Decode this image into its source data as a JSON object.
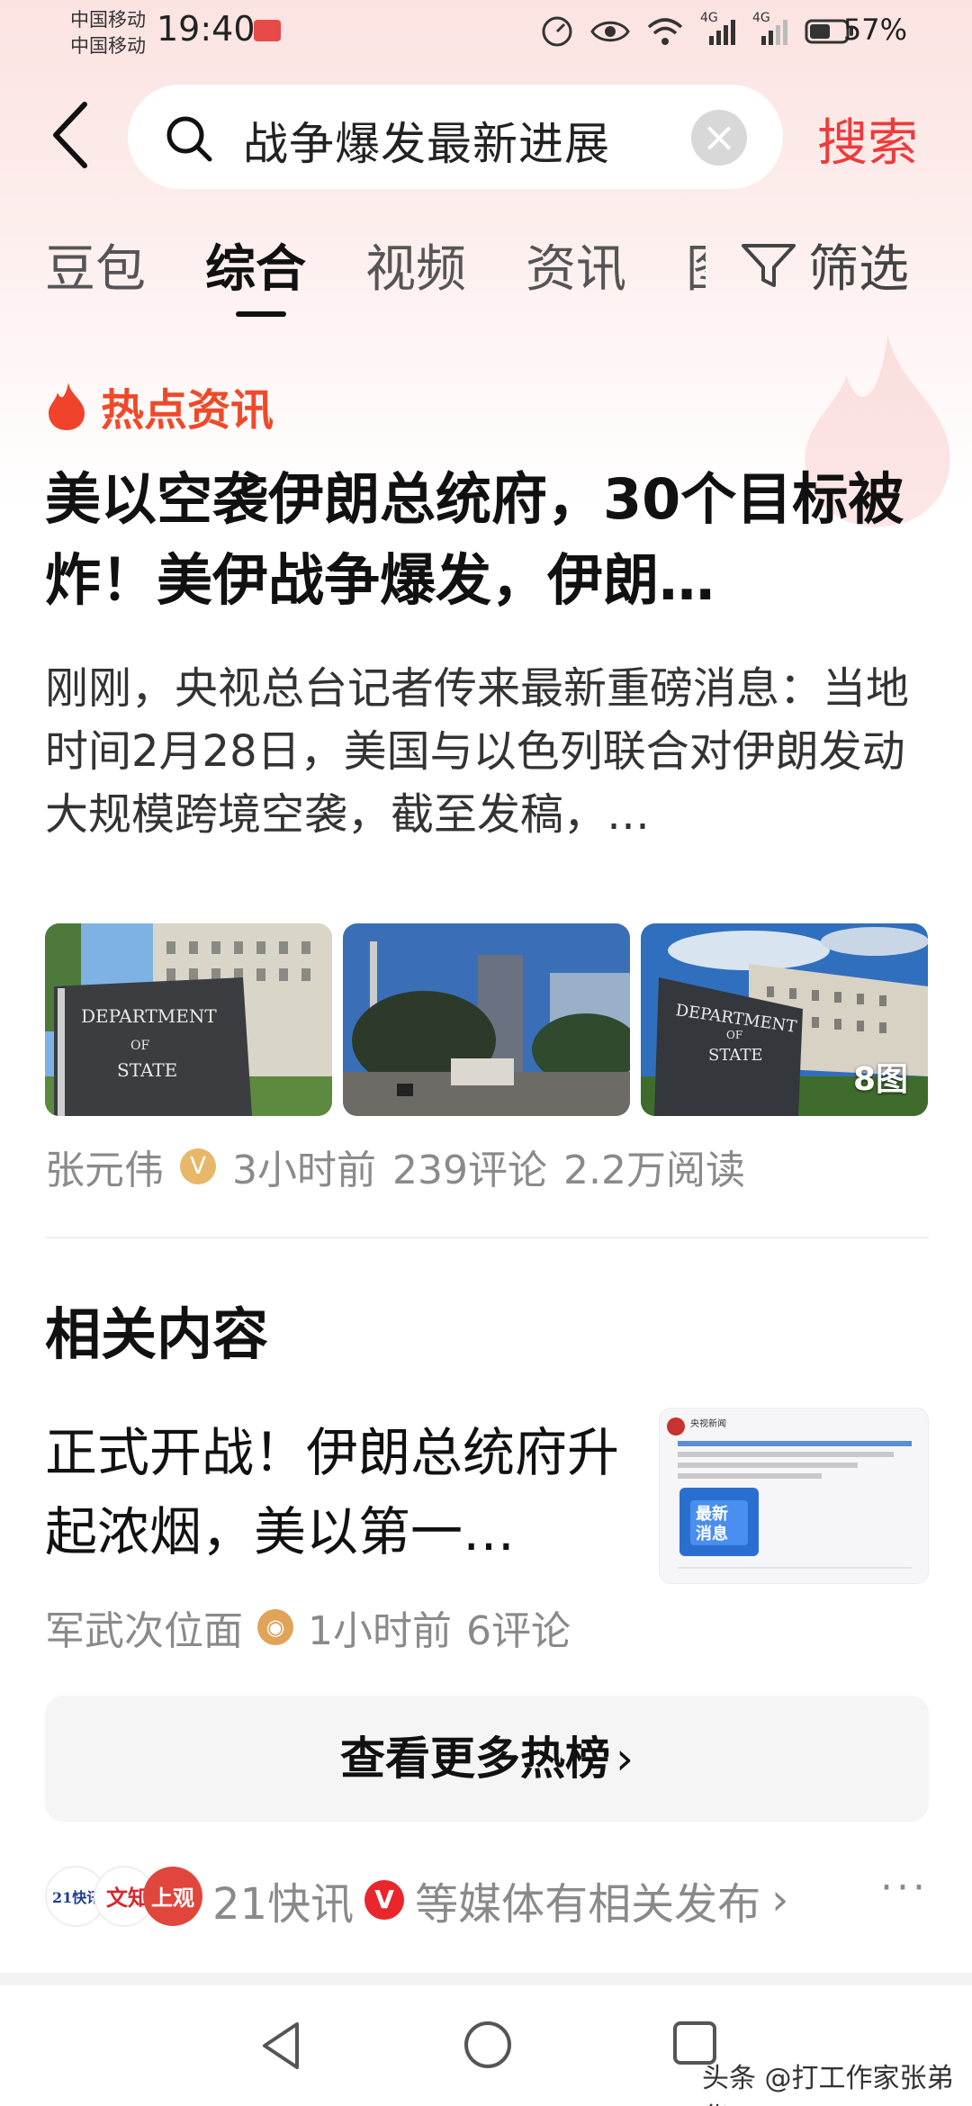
{
  "status_bar": {
    "carrier_1": "中国移动",
    "carrier_2": "中国移动",
    "time": "19:40",
    "battery": "57%",
    "signal_1": "4G",
    "signal_2": "4G"
  },
  "search": {
    "query": "战争爆发最新进展",
    "submit_label": "搜索"
  },
  "tabs": [
    {
      "label": "豆包"
    },
    {
      "label": "综合",
      "active": true
    },
    {
      "label": "视频"
    },
    {
      "label": "资讯"
    },
    {
      "label": "图"
    }
  ],
  "filter_label": "筛选",
  "hot_section": {
    "title": "热点资讯",
    "headline": "美以空袭伊朗总统府，30个目标被炸！美伊战争爆发，伊朗…",
    "summary": "刚刚，央视总台记者传来最新重磅消息：当地时间2月28日，美国与以色列联合对伊朗发动大规模跨境空袭，截至发稿，…",
    "photo_count": "8图",
    "author": "张元伟",
    "time_ago": "3小时前",
    "comments": "239评论",
    "reads": "2.2万阅读"
  },
  "related": {
    "title": "相关内容",
    "item_title": "正式开战！伊朗总统府升起浓烟，美以第一…",
    "thumb_badge": "最新消息",
    "thumb_source": "央视新闻",
    "author": "军武次位面",
    "time_ago": "1小时前",
    "comments": "6评论"
  },
  "more_button": "查看更多热榜",
  "media": {
    "logo_1": "21快讯",
    "logo_2": "文知",
    "logo_3": "上观",
    "text_source": "21快讯",
    "text_suffix": "等媒体有相关发布"
  },
  "watermark": "头条 @打工作家张弟华",
  "colors": {
    "accent_red": "#ee3b3b",
    "hot_orange": "#ee4a2a",
    "meta_gray": "#8a8a8a"
  },
  "icons": [
    "back-arrow-icon",
    "search-icon",
    "clear-icon",
    "filter-icon",
    "flame-icon",
    "verified-icon",
    "chevron-right-icon",
    "more-icon",
    "nav-back-icon",
    "nav-home-icon",
    "nav-recent-icon"
  ]
}
